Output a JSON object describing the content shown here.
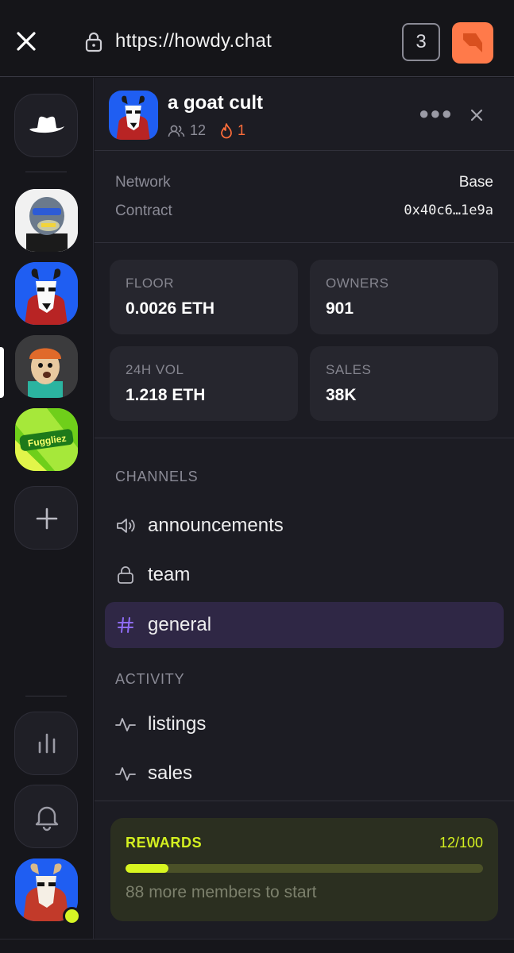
{
  "browser": {
    "url": "https://howdy.chat",
    "tab_count": "3",
    "accent": "#ff7a4a"
  },
  "rail": {
    "servers": [
      {
        "name": "bored-ape-icon"
      },
      {
        "name": "goat-cult-icon",
        "active": true
      },
      {
        "name": "beanie-guy-icon"
      },
      {
        "name": "fuggliez-icon",
        "text": "Fuggliez"
      }
    ]
  },
  "header": {
    "title": "a goat cult",
    "members": "12",
    "fire": "1"
  },
  "meta": {
    "network_label": "Network",
    "network_value": "Base",
    "contract_label": "Contract",
    "contract_value": "0x40c6…1e9a"
  },
  "stats": [
    {
      "label": "FLOOR",
      "value": "0.0026 ETH"
    },
    {
      "label": "OWNERS",
      "value": "901"
    },
    {
      "label": "24H VOL",
      "value": "1.218 ETH"
    },
    {
      "label": "SALES",
      "value": "38K"
    }
  ],
  "channels": {
    "heading": "CHANNELS",
    "items": [
      {
        "label": "announcements",
        "icon": "speaker-icon"
      },
      {
        "label": "team",
        "icon": "lock-icon"
      },
      {
        "label": "general",
        "icon": "hash-icon",
        "active": true
      }
    ]
  },
  "activity": {
    "heading": "ACTIVITY",
    "items": [
      {
        "label": "listings",
        "icon": "pulse-icon"
      },
      {
        "label": "sales",
        "icon": "pulse-icon"
      }
    ]
  },
  "rewards": {
    "title": "REWARDS",
    "count": "12/100",
    "progress": 0.12,
    "subtitle": "88 more members to start",
    "color": "#d4f020"
  }
}
